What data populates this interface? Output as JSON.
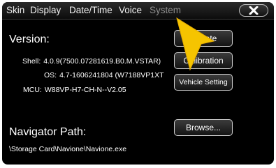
{
  "menu": {
    "tabs": [
      {
        "label": "Skin"
      },
      {
        "label": "Display"
      },
      {
        "label": "Date/Time"
      },
      {
        "label": "Voice"
      },
      {
        "label": "System"
      }
    ],
    "active_tab": "System"
  },
  "version": {
    "heading": "Version:",
    "shell_label": "Shell:",
    "shell_value": "4.0.9(7500.07281619.B0.M.VSTAR)",
    "os_label": "OS:",
    "os_value": "4.7-1606241804 (W7188VP1XT",
    "mcu_label": "MCU:",
    "mcu_value": "W88VP-H7-CH-N--V2.05"
  },
  "buttons": {
    "update": "Update",
    "calibration": "Calibration",
    "vehicle_setting": "Vehicle Setting",
    "browse": "Browse..."
  },
  "navigator": {
    "heading": "Navigator Path:",
    "path": "\\Storage Card\\Navione\\Navione.exe"
  },
  "icons": {
    "close": "close-icon",
    "pointer": "arrow-pointer-icon"
  },
  "colors": {
    "background": "#000000",
    "text": "#ffffff",
    "inactive_tab": "#8e8e8e",
    "pointer": "#f5c400"
  }
}
